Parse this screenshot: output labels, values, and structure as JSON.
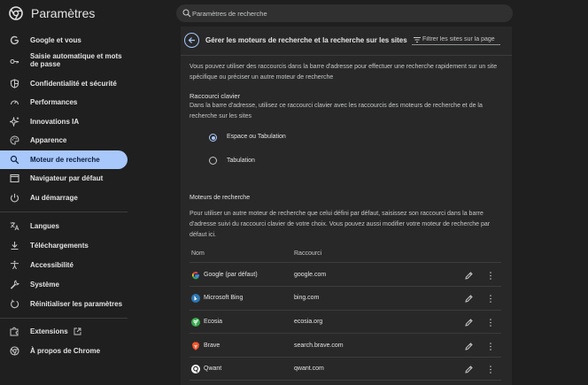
{
  "app": {
    "title": "Paramètres"
  },
  "search": {
    "placeholder": "Paramètres de recherche"
  },
  "sidebar": {
    "items": [
      {
        "label": "Google et vous",
        "icon": "google-icon"
      },
      {
        "label": "Saisie automatique et mots de passe",
        "icon": "key-icon"
      },
      {
        "label": "Confidentialité et sécurité",
        "icon": "shield-icon"
      },
      {
        "label": "Performances",
        "icon": "gauge-icon"
      },
      {
        "label": "Innovations IA",
        "icon": "sparkle-icon"
      },
      {
        "label": "Apparence",
        "icon": "palette-icon"
      },
      {
        "label": "Moteur de recherche",
        "icon": "search-icon",
        "active": true
      },
      {
        "label": "Navigateur par défaut",
        "icon": "browser-icon"
      },
      {
        "label": "Au démarrage",
        "icon": "power-icon"
      },
      {
        "label": "Langues",
        "icon": "translate-icon"
      },
      {
        "label": "Téléchargements",
        "icon": "download-icon"
      },
      {
        "label": "Accessibilité",
        "icon": "accessibility-icon"
      },
      {
        "label": "Système",
        "icon": "wrench-icon"
      },
      {
        "label": "Réinitialiser les paramètres",
        "icon": "reset-icon"
      },
      {
        "label": "Extensions",
        "icon": "puzzle-icon"
      },
      {
        "label": "À propos de Chrome",
        "icon": "chrome-icon"
      }
    ]
  },
  "main": {
    "title": "Gérer les moteurs de recherche et la recherche sur les sites",
    "filter_placeholder": "Filtrer les sites sur la page",
    "intro": "Vous pouvez utiliser des raccourcis dans la barre d'adresse pour effectuer une recherche rapidement sur un site spécifique ou préciser un autre moteur de recherche",
    "shortcut": {
      "heading": "Raccourci clavier",
      "description": "Dans la barre d'adresse, utilisez ce raccourci clavier avec les raccourcis des moteurs de recherche et de la recherche sur les sites",
      "options": [
        {
          "label": "Espace ou Tabulation",
          "checked": true
        },
        {
          "label": "Tabulation",
          "checked": false
        }
      ]
    },
    "engines": {
      "heading": "Moteurs de recherche",
      "description": "Pour utiliser un autre moteur de recherche que celui défini par défaut, saisissez son raccourci dans la barre d'adresse suivi du raccourci clavier de votre choix. Vous pouvez aussi modifier votre moteur de recherche par défaut ici.",
      "columns": {
        "name": "Nom",
        "shortcut": "Raccourci"
      },
      "rows": [
        {
          "name": "Google (par défaut)",
          "shortcut": "google.com",
          "icon": "google-g-icon"
        },
        {
          "name": "Microsoft Bing",
          "shortcut": "bing.com",
          "icon": "bing-icon"
        },
        {
          "name": "Ecosia",
          "shortcut": "ecosia.org",
          "icon": "ecosia-icon"
        },
        {
          "name": "Brave",
          "shortcut": "search.brave.com",
          "icon": "brave-icon"
        },
        {
          "name": "Qwant",
          "shortcut": "qwant.com",
          "icon": "qwant-icon"
        }
      ]
    }
  }
}
